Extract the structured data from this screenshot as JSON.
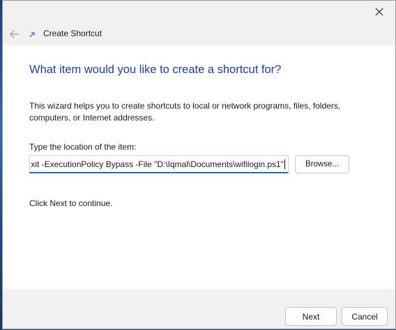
{
  "wizard": {
    "header_title": "Create Shortcut",
    "heading": "What item would you like to create a shortcut for?",
    "description": "This wizard helps you to create shortcuts to local or network programs, files, folders, computers, or Internet addresses.",
    "location_label": "Type the location of the item:",
    "location_value": "xit -ExecutionPolicy Bypass -File \"D:\\Iqmal\\Documents\\wifilogin.ps1\"",
    "browse_label": "Browse...",
    "continue_text": "Click Next to continue."
  },
  "footer": {
    "next_label": "Next",
    "cancel_label": "Cancel"
  },
  "icons": {
    "close": "close-icon",
    "back": "back-arrow-icon",
    "wizard": "shortcut-arrow-icon"
  },
  "colors": {
    "heading": "#1e3f8f",
    "input_focus": "#2a64b9"
  }
}
